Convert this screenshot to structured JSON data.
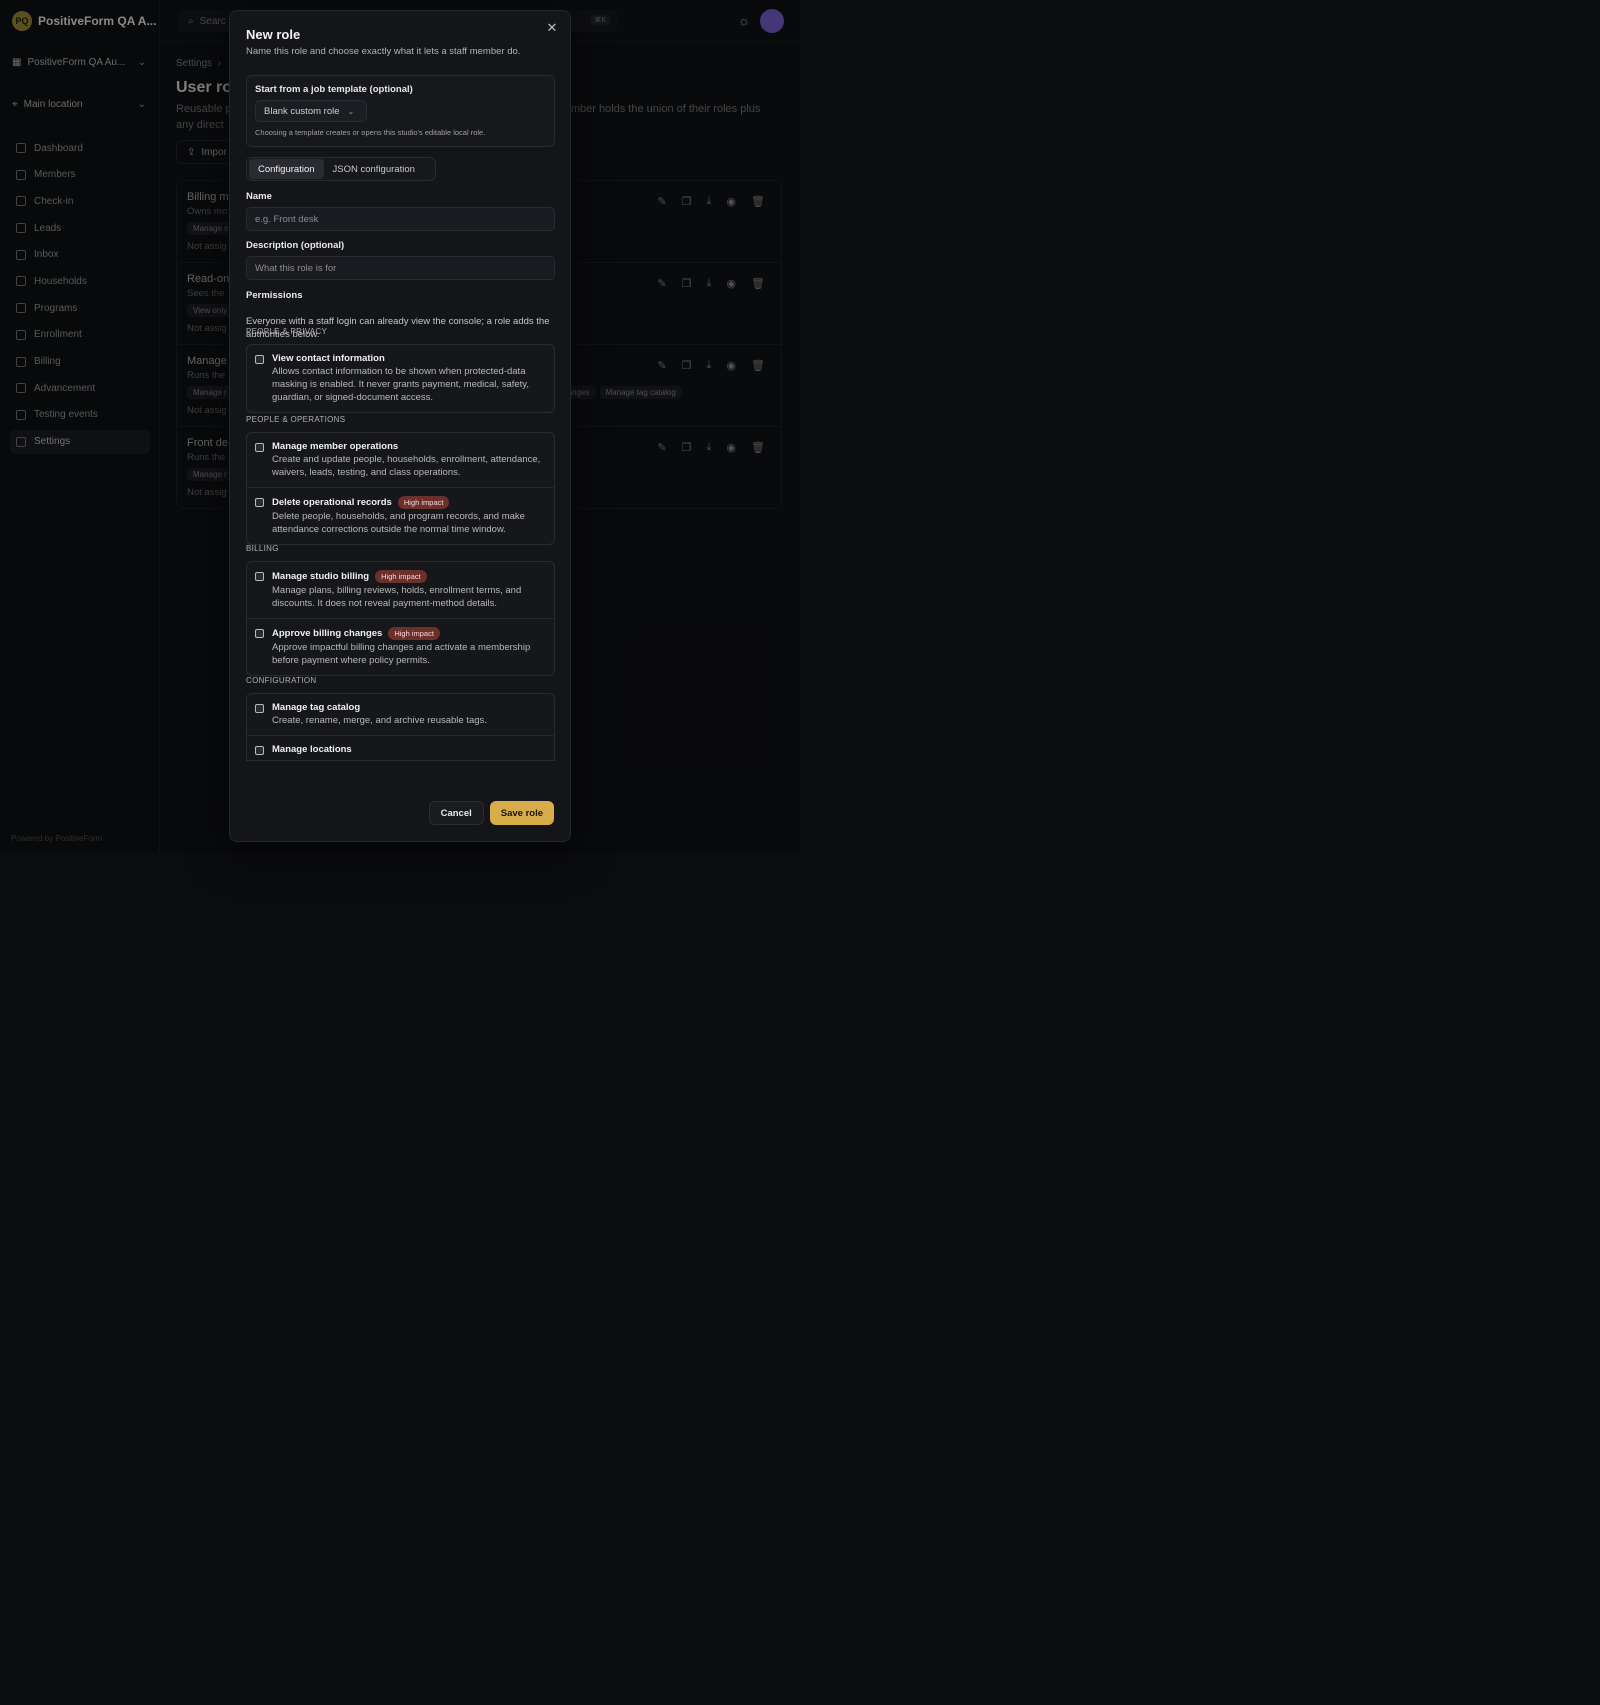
{
  "app": {
    "brand_initials": "PQ",
    "brand_name": "PositiveForm QA A...",
    "org_select": "PositiveForm QA Au...",
    "location_select": "Main location",
    "nav": [
      "Dashboard",
      "Members",
      "Check-in",
      "Leads",
      "Inbox",
      "Households",
      "Programs",
      "Enrollment",
      "Billing",
      "Advancement",
      "Testing events",
      "Settings"
    ],
    "active_nav": "Settings",
    "powered_by": "Powered by PositiveForm",
    "search_placeholder": "Searc",
    "search_kbd": "⌘K",
    "breadcrumb": "Settings",
    "page_title": "User ro",
    "page_sub_left": "Reusable p",
    "page_sub_right": "ember holds the union of their roles plus",
    "page_sub_line2": "any direct",
    "import_label": "Impor",
    "roles": [
      {
        "name": "Billing m",
        "desc": "Owns mo",
        "chips": [
          "Manage s"
        ],
        "assigned": "Not assig"
      },
      {
        "name": "Read-on",
        "desc": "Sees the",
        "chips": [
          "View only"
        ],
        "assigned": "Not assig"
      },
      {
        "name": "Manage",
        "desc": "Runs the",
        "chips": [
          "Manage r",
          "lling changes",
          "Manage tag catalog"
        ],
        "assigned": "Not assig"
      },
      {
        "name": "Front de",
        "desc": "Runs the",
        "chips": [
          "Manage r"
        ],
        "assigned": "Not assig"
      }
    ]
  },
  "modal": {
    "title": "New role",
    "subtitle": "Name this role and choose exactly what it lets a staff member do.",
    "template_label": "Start from a job template (optional)",
    "template_value": "Blank custom role",
    "template_hint": "Choosing a template creates or opens this studio's editable local role.",
    "tabs": [
      "Configuration",
      "JSON configuration"
    ],
    "active_tab": "Configuration",
    "name_label": "Name",
    "name_placeholder": "e.g. Front desk",
    "desc_label": "Description (optional)",
    "desc_placeholder": "What this role is for",
    "permissions_label": "Permissions",
    "permissions_help": "Everyone with a staff login can already view the console; a role adds the authorities below.",
    "sections": [
      {
        "label": "PEOPLE & PRIVACY",
        "items": [
          {
            "title": "View contact information",
            "badge": "",
            "desc": "Allows contact information to be shown when protected-data masking is enabled. It never grants payment, medical, safety, guardian, or signed-document access."
          }
        ]
      },
      {
        "label": "PEOPLE & OPERATIONS",
        "items": [
          {
            "title": "Manage member operations",
            "badge": "",
            "desc": "Create and update people, households, enrollment, attendance, waivers, leads, testing, and class operations."
          },
          {
            "title": "Delete operational records",
            "badge": "High impact",
            "desc": "Delete people, households, and program records, and make attendance corrections outside the normal time window."
          }
        ]
      },
      {
        "label": "BILLING",
        "items": [
          {
            "title": "Manage studio billing",
            "badge": "High impact",
            "desc": "Manage plans, billing reviews, holds, enrollment terms, and discounts. It does not reveal payment-method details."
          },
          {
            "title": "Approve billing changes",
            "badge": "High impact",
            "desc": "Approve impactful billing changes and activate a membership before payment where policy permits."
          }
        ]
      },
      {
        "label": "CONFIGURATION",
        "items": [
          {
            "title": "Manage tag catalog",
            "badge": "",
            "desc": "Create, rename, merge, and archive reusable tags."
          },
          {
            "title": "Manage locations",
            "badge": "",
            "desc": ""
          }
        ]
      }
    ],
    "cancel_label": "Cancel",
    "save_label": "Save role"
  },
  "colors": {
    "accent": "#d7ad4b",
    "badge_bg": "#6d2f2a",
    "background": "#0b0c0f"
  }
}
